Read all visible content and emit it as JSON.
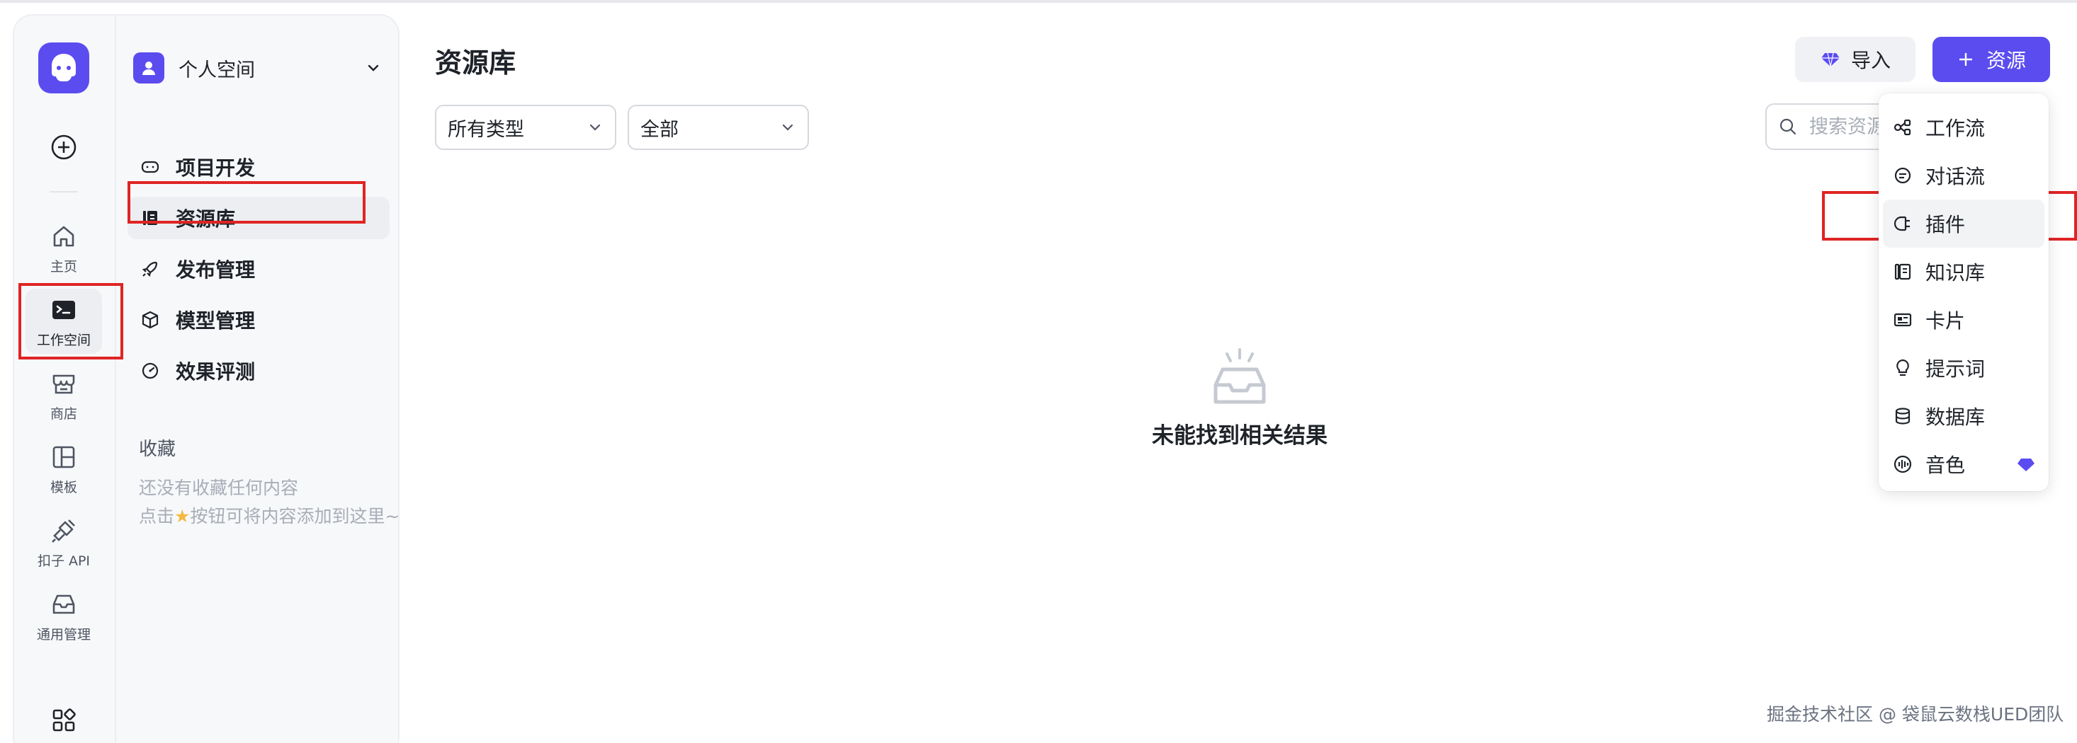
{
  "rail": {
    "items": [
      {
        "label": "主页",
        "icon": "home-icon"
      },
      {
        "label": "工作空间",
        "icon": "terminal-icon"
      },
      {
        "label": "商店",
        "icon": "store-icon"
      },
      {
        "label": "模板",
        "icon": "layout-icon"
      },
      {
        "label": "扣子 API",
        "icon": "plug-icon"
      },
      {
        "label": "通用管理",
        "icon": "inbox-icon"
      }
    ]
  },
  "panel": {
    "space_name": "个人空间",
    "nav": [
      {
        "label": "项目开发",
        "icon": "gamepad-icon"
      },
      {
        "label": "资源库",
        "icon": "library-icon"
      },
      {
        "label": "发布管理",
        "icon": "rocket-icon"
      },
      {
        "label": "模型管理",
        "icon": "cube-icon"
      },
      {
        "label": "效果评测",
        "icon": "gauge-icon"
      }
    ],
    "favorites_title": "收藏",
    "favorites_empty_line1": "还没有收藏任何内容",
    "favorites_empty_line2_pre": "点击",
    "favorites_empty_line2_post": "按钮可将内容添加到这里~"
  },
  "main": {
    "title": "资源库",
    "import_label": "导入",
    "add_resource_label": "资源",
    "filter_type": "所有类型",
    "filter_scope": "全部",
    "search_placeholder": "搜索资源",
    "empty_text": "未能找到相关结果"
  },
  "dropdown": {
    "items": [
      {
        "label": "工作流",
        "icon": "workflow-icon"
      },
      {
        "label": "对话流",
        "icon": "chat-flow-icon"
      },
      {
        "label": "插件",
        "icon": "plugin-icon"
      },
      {
        "label": "知识库",
        "icon": "knowledge-icon"
      },
      {
        "label": "卡片",
        "icon": "card-icon"
      },
      {
        "label": "提示词",
        "icon": "bulb-icon"
      },
      {
        "label": "数据库",
        "icon": "database-icon"
      },
      {
        "label": "音色",
        "icon": "voice-icon"
      }
    ]
  },
  "watermark": "掘金技术社区 @ 袋鼠云数栈UED团队",
  "colors": {
    "accent": "#5b4cf0",
    "highlight": "#e02424"
  }
}
